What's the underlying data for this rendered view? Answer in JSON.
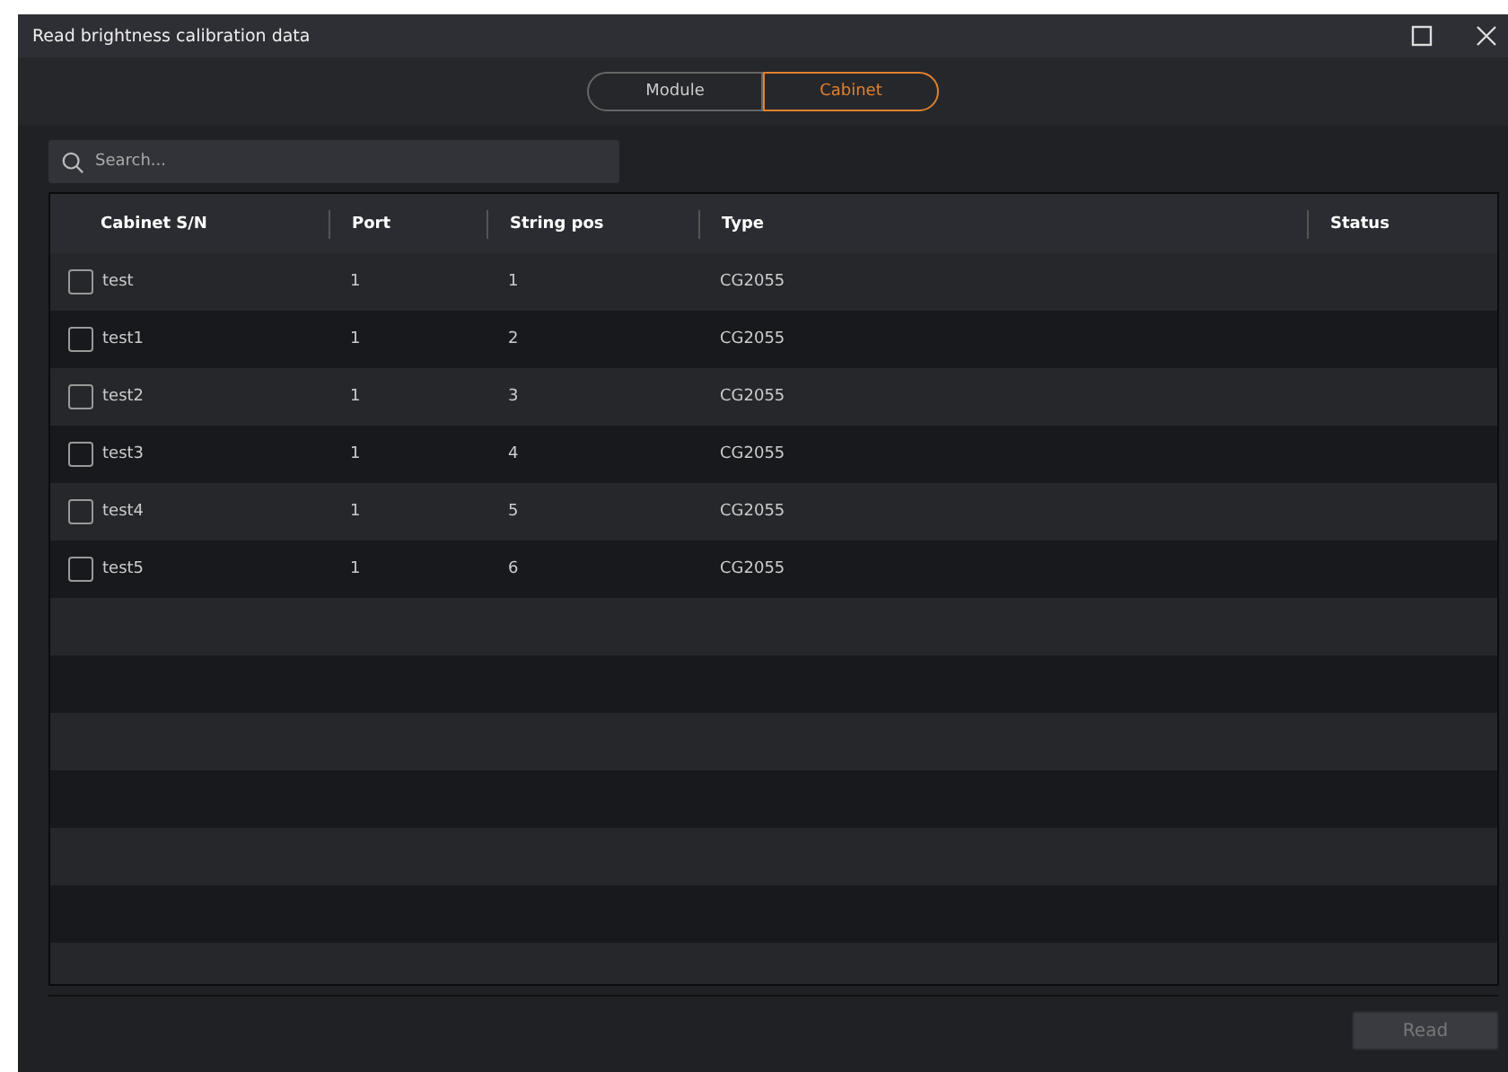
{
  "window": {
    "title": "Read brightness calibration data"
  },
  "tabs": [
    {
      "label": "Module",
      "selected": false
    },
    {
      "label": "Cabinet",
      "selected": true
    }
  ],
  "search": {
    "placeholder": "Search..."
  },
  "table": {
    "columns": [
      "Cabinet S/N",
      "Port",
      "String pos",
      "Type",
      "Status"
    ],
    "rows": [
      {
        "cells": [
          "test",
          "1",
          "1",
          "CG2055",
          ""
        ],
        "checked": false
      },
      {
        "cells": [
          "test1",
          "1",
          "2",
          "CG2055",
          ""
        ],
        "checked": false
      },
      {
        "cells": [
          "test2",
          "1",
          "3",
          "CG2055",
          ""
        ],
        "checked": false
      },
      {
        "cells": [
          "test3",
          "1",
          "4",
          "CG2055",
          ""
        ],
        "checked": false
      },
      {
        "cells": [
          "test4",
          "1",
          "5",
          "CG2055",
          ""
        ],
        "checked": false
      },
      {
        "cells": [
          "test5",
          "1",
          "6",
          "CG2055",
          ""
        ],
        "checked": false
      }
    ]
  },
  "buttons": [
    {
      "label": "Read",
      "disabled": true
    }
  ]
}
